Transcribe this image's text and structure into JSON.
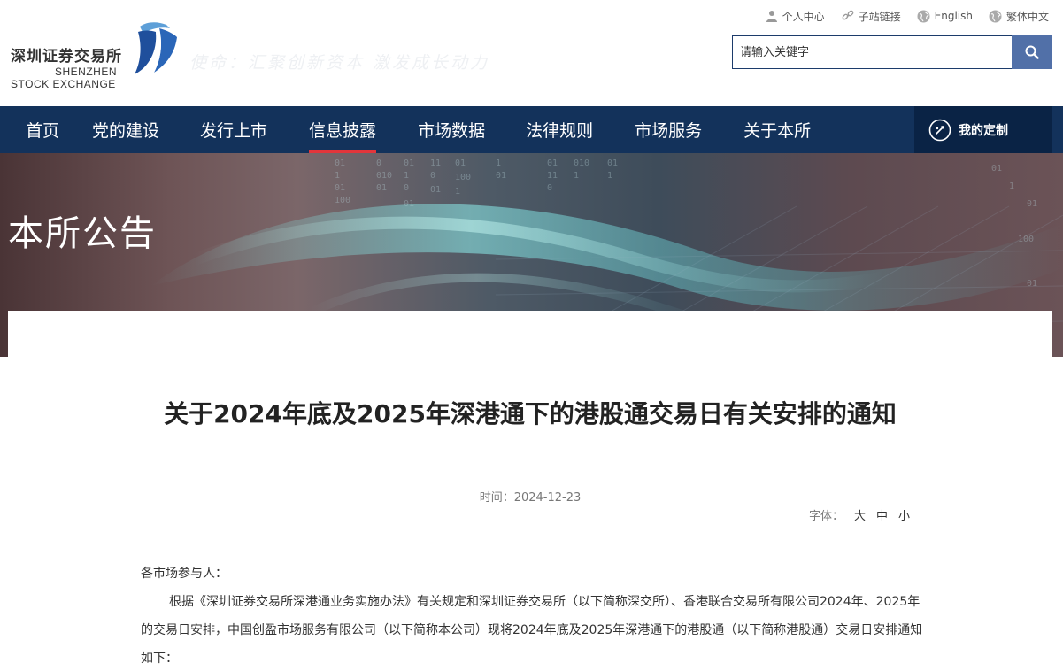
{
  "header": {
    "logo_cn": "深圳证券交易所",
    "logo_en_line1": "SHENZHEN",
    "logo_en_line2": "STOCK EXCHANGE",
    "slogan": "使命：汇聚创新资本  激发成长动力"
  },
  "toplinks": [
    {
      "label": "个人中心",
      "icon": "user-icon"
    },
    {
      "label": "子站链接",
      "icon": "link-icon"
    },
    {
      "label": "English",
      "icon": "globe-icon"
    },
    {
      "label": "繁体中文",
      "icon": "globe-icon"
    }
  ],
  "search": {
    "placeholder": "请输入关键字",
    "icon": "search-icon"
  },
  "nav": {
    "items": [
      {
        "label": "首页"
      },
      {
        "label": "党的建设"
      },
      {
        "label": "发行上市"
      },
      {
        "label": "信息披露",
        "active": true
      },
      {
        "label": "市场数据"
      },
      {
        "label": "法律规则"
      },
      {
        "label": "市场服务"
      },
      {
        "label": "关于本所"
      }
    ],
    "custom_label": "我的定制"
  },
  "banner": {
    "title": "本所公告",
    "digits": [
      "01",
      "100",
      "11",
      "01",
      "0",
      "1",
      "010",
      "01",
      "11",
      "0"
    ]
  },
  "article": {
    "title": "关于2024年底及2025年深港通下的港股通交易日有关安排的通知",
    "date_label": "时间：",
    "date": "2024-12-23",
    "font_label": "字体：",
    "font_options": [
      "大",
      "中",
      "小"
    ],
    "greeting": "各市场参与人：",
    "body": "根据《深圳证券交易所深港通业务实施办法》有关规定和深圳证券交易所（以下简称深交所）、香港联合交易所有限公司2024年、2025年的交易日安排，中国创盈市场服务有限公司（以下简称本公司）现将2024年底及2025年深港通下的港股通（以下简称港股通）交易日安排通知如下："
  },
  "colors": {
    "nav_bg": "#13325b",
    "active_underline": "#e2353b",
    "search_button": "#5170a8"
  }
}
